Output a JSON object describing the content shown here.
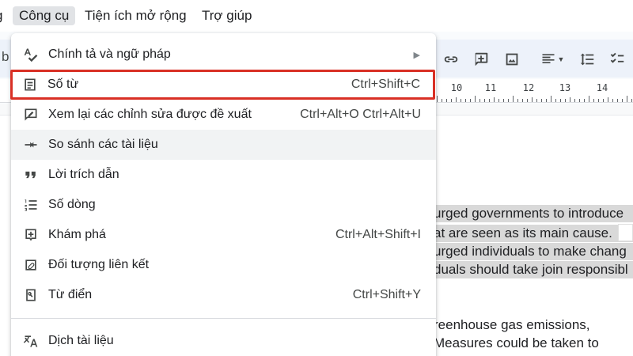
{
  "menubar": {
    "partial_item": "g",
    "items": [
      "Công cụ",
      "Tiện ích mở rộng",
      "Trợ giúp"
    ]
  },
  "toolbar": {
    "partial_label": "b",
    "buttons": [
      "link-icon",
      "comment-add-icon",
      "image-icon",
      "align-left-icon",
      "line-spacing-icon",
      "checklist-icon"
    ]
  },
  "ruler": {
    "numbers": [
      "10",
      "11",
      "12",
      "13",
      "14"
    ]
  },
  "menu": {
    "items": [
      {
        "icon": "spellcheck-icon",
        "label": "Chính tả và ngữ pháp",
        "shortcut": "",
        "submenu": true
      },
      {
        "icon": "word-count-icon",
        "label": "Số từ",
        "shortcut": "Ctrl+Shift+C",
        "highlighted": true
      },
      {
        "icon": "review-edits-icon",
        "label": "Xem lại các chỉnh sửa được đề xuất",
        "shortcut": "Ctrl+Alt+O Ctrl+Alt+U"
      },
      {
        "icon": "compare-docs-icon",
        "label": "So sánh các tài liệu",
        "shortcut": "",
        "hover": true
      },
      {
        "icon": "citations-icon",
        "label": "Lời trích dẫn",
        "shortcut": ""
      },
      {
        "icon": "line-numbers-icon",
        "label": "Số dòng",
        "shortcut": ""
      },
      {
        "icon": "explore-icon",
        "label": "Khám phá",
        "shortcut": "Ctrl+Alt+Shift+I"
      },
      {
        "icon": "linked-objects-icon",
        "label": "Đối tượng liên kết",
        "shortcut": ""
      },
      {
        "icon": "dictionary-icon",
        "label": "Từ điển",
        "shortcut": "Ctrl+Shift+Y"
      },
      {
        "icon": "translate-icon",
        "label": "Dịch tài liệu",
        "shortcut": ""
      }
    ]
  },
  "document": {
    "lines": [
      " urged governments to introduce",
      "at are seen as its main cause.",
      " urged individuals to make chang",
      "duals should take join responsibl",
      "reenhouse gas emissions,",
      "Measures could be taken to"
    ]
  },
  "colors": {
    "highlight_box": "#d93025",
    "text_highlight": "#d9d9d9",
    "toolbar_bg": "#edf2fa"
  }
}
